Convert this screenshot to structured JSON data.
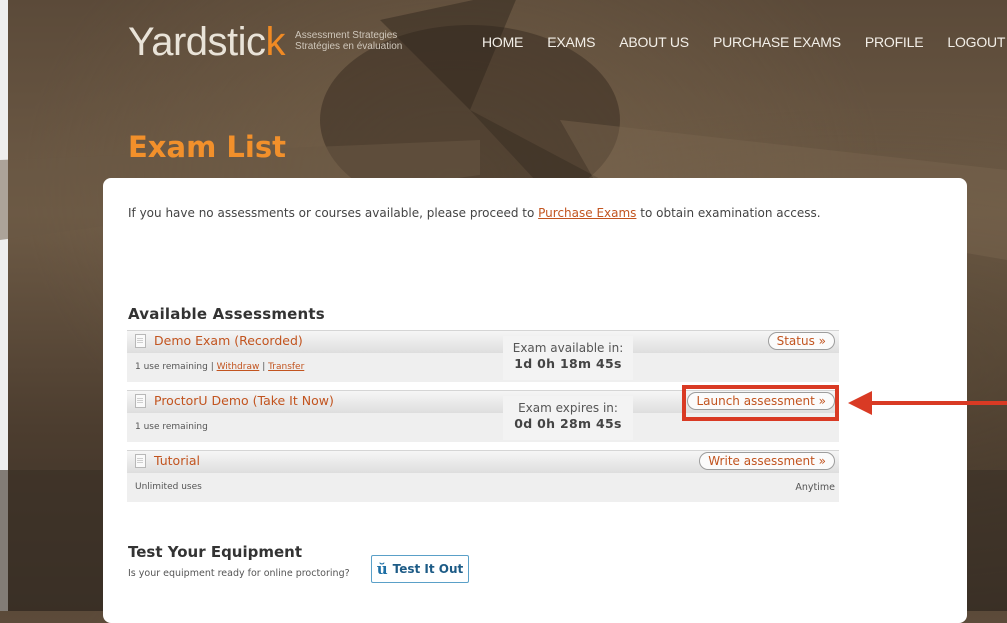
{
  "header": {
    "logo_main": "Yardstic",
    "logo_k": "k",
    "logo_sub_line1": "Assessment Strategies",
    "logo_sub_line2": "Stratégies en évaluation",
    "nav": [
      "HOME",
      "EXAMS",
      "ABOUT US",
      "PURCHASE EXAMS",
      "PROFILE",
      "LOGOUT"
    ]
  },
  "page_title": "Exam List",
  "intro": {
    "before": "If you have no assessments or courses available, please proceed to ",
    "link": "Purchase Exams",
    "after": " to obtain examination access."
  },
  "available": {
    "title": "Available Assessments",
    "rows": [
      {
        "name": "Demo Exam (Recorded)",
        "uses": "1 use remaining",
        "sep1": " | ",
        "link1": "Withdraw",
        "sep2": " | ",
        "link2": "Transfer",
        "timer_label": "Exam available in:",
        "timer_value": "1d 0h 18m 45s",
        "action": "Status »"
      },
      {
        "name": "ProctorU Demo (Take It Now)",
        "uses": "1 use remaining",
        "timer_label": "Exam expires in:",
        "timer_value": "0d 0h 28m 45s",
        "action": "Launch assessment »"
      },
      {
        "name": "Tutorial",
        "uses": "Unlimited uses",
        "action": "Write assessment »",
        "note": "Anytime"
      }
    ]
  },
  "equipment": {
    "title": "Test Your Equipment",
    "subtitle": "Is your equipment ready for online proctoring?",
    "button": "Test It Out"
  },
  "colors": {
    "accent_orange": "#f2902b",
    "link": "#c2541f",
    "annotation_red": "#d93a24"
  }
}
